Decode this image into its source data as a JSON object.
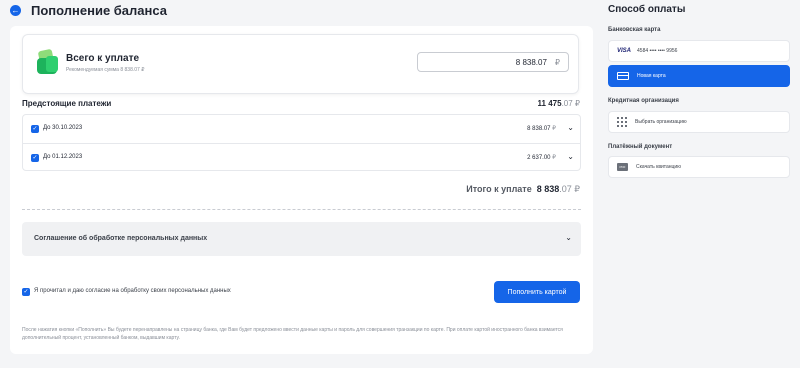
{
  "header": {
    "back_icon": "arrow-left-icon",
    "title": "Пополнение баланса"
  },
  "total": {
    "title": "Всего к уплате",
    "subtitle": "Рекомендуемая сумма 8 838.07 ₽",
    "amount_value": "8 838.07",
    "currency": "₽"
  },
  "upcoming": {
    "label": "Предстоящие платежи",
    "total_int": "11 475",
    "total_dec": ".07 ₽",
    "items": [
      {
        "label": "До 30.10.2023",
        "amount": "8 838.07",
        "currency": "₽"
      },
      {
        "label": "До 01.12.2023",
        "amount": "2 637.00",
        "currency": "₽"
      }
    ]
  },
  "grand_total": {
    "label": "Итого к уплате",
    "int": "8 838",
    "dec": ".07 ₽"
  },
  "agreement": {
    "label": "Соглашение об обработке персональных данных"
  },
  "consent": {
    "label": "Я прочитал и даю согласие на обработку своих персональных данных"
  },
  "pay_button": {
    "label": "Пополнить картой"
  },
  "footnote": "После нажатия кнопки «Пополнить» Вы будете перенаправлены на страницу банка, где Вам будет предложено ввести данные карты и пароль для совершения транзакции по карте. При оплате картой иностранного банка взимается дополнительный процент, установленный банком, выдавшим карту.",
  "sidebar": {
    "title": "Способ оплаты",
    "bank_card_label": "Банковская карта",
    "visa_brand": "VISA",
    "visa_card": "4584 •••• •••• 9956",
    "new_card": "Новая карта",
    "credit_org_label": "Кредитная организация",
    "choose_org": "Выбрать организацию",
    "payment_doc_label": "Платёжный документ",
    "pdf_badge": "PDF",
    "download_receipt": "Скачать квитанцию"
  },
  "colors": {
    "accent": "#1565e8",
    "background": "#f4f5f7"
  }
}
